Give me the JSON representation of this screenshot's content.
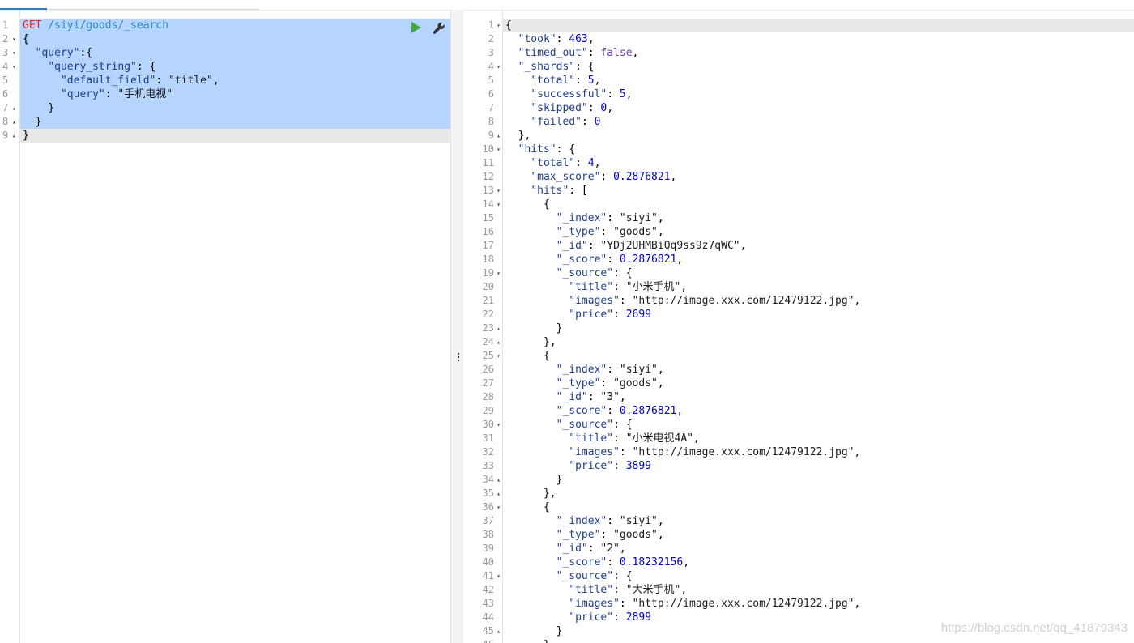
{
  "request": {
    "method": "GET",
    "path": " /siyi/goods/_search",
    "lines": [
      [
        {
          "c": "p",
          "t": "{"
        }
      ],
      [
        {
          "c": "p",
          "t": "  "
        },
        {
          "c": "k",
          "t": "\"query\""
        },
        {
          "c": "p",
          "t": ":{"
        }
      ],
      [
        {
          "c": "p",
          "t": "    "
        },
        {
          "c": "k",
          "t": "\"query_string\""
        },
        {
          "c": "p",
          "t": ": {"
        }
      ],
      [
        {
          "c": "p",
          "t": "      "
        },
        {
          "c": "k",
          "t": "\"default_field\""
        },
        {
          "c": "p",
          "t": ": "
        },
        {
          "c": "s",
          "t": "\"title\""
        },
        {
          "c": "p",
          "t": ","
        }
      ],
      [
        {
          "c": "p",
          "t": "      "
        },
        {
          "c": "k",
          "t": "\"query\""
        },
        {
          "c": "p",
          "t": ": "
        },
        {
          "c": "s",
          "t": "\"手机电视\""
        }
      ],
      [
        {
          "c": "p",
          "t": "    }"
        }
      ],
      [
        {
          "c": "p",
          "t": "  }"
        }
      ],
      [
        {
          "c": "p",
          "t": "}"
        }
      ]
    ],
    "line_numbers": [
      "1",
      "2",
      "3",
      "4",
      "5",
      "6",
      "7",
      "8",
      "9"
    ],
    "folds": [
      "",
      "down",
      "down",
      "down",
      "",
      "",
      "up",
      "up",
      "up"
    ],
    "run_icon": "play-icon",
    "settings_icon": "wrench-icon"
  },
  "response": {
    "lines": [
      [
        {
          "c": "p",
          "t": "{"
        }
      ],
      [
        {
          "c": "p",
          "t": "  "
        },
        {
          "c": "k",
          "t": "\"took\""
        },
        {
          "c": "p",
          "t": ": "
        },
        {
          "c": "n",
          "t": "463"
        },
        {
          "c": "p",
          "t": ","
        }
      ],
      [
        {
          "c": "p",
          "t": "  "
        },
        {
          "c": "k",
          "t": "\"timed_out\""
        },
        {
          "c": "p",
          "t": ": "
        },
        {
          "c": "b",
          "t": "false"
        },
        {
          "c": "p",
          "t": ","
        }
      ],
      [
        {
          "c": "p",
          "t": "  "
        },
        {
          "c": "k",
          "t": "\"_shards\""
        },
        {
          "c": "p",
          "t": ": {"
        }
      ],
      [
        {
          "c": "p",
          "t": "    "
        },
        {
          "c": "k",
          "t": "\"total\""
        },
        {
          "c": "p",
          "t": ": "
        },
        {
          "c": "n",
          "t": "5"
        },
        {
          "c": "p",
          "t": ","
        }
      ],
      [
        {
          "c": "p",
          "t": "    "
        },
        {
          "c": "k",
          "t": "\"successful\""
        },
        {
          "c": "p",
          "t": ": "
        },
        {
          "c": "n",
          "t": "5"
        },
        {
          "c": "p",
          "t": ","
        }
      ],
      [
        {
          "c": "p",
          "t": "    "
        },
        {
          "c": "k",
          "t": "\"skipped\""
        },
        {
          "c": "p",
          "t": ": "
        },
        {
          "c": "n",
          "t": "0"
        },
        {
          "c": "p",
          "t": ","
        }
      ],
      [
        {
          "c": "p",
          "t": "    "
        },
        {
          "c": "k",
          "t": "\"failed\""
        },
        {
          "c": "p",
          "t": ": "
        },
        {
          "c": "n",
          "t": "0"
        }
      ],
      [
        {
          "c": "p",
          "t": "  },"
        }
      ],
      [
        {
          "c": "p",
          "t": "  "
        },
        {
          "c": "k",
          "t": "\"hits\""
        },
        {
          "c": "p",
          "t": ": {"
        }
      ],
      [
        {
          "c": "p",
          "t": "    "
        },
        {
          "c": "k",
          "t": "\"total\""
        },
        {
          "c": "p",
          "t": ": "
        },
        {
          "c": "n",
          "t": "4"
        },
        {
          "c": "p",
          "t": ","
        }
      ],
      [
        {
          "c": "p",
          "t": "    "
        },
        {
          "c": "k",
          "t": "\"max_score\""
        },
        {
          "c": "p",
          "t": ": "
        },
        {
          "c": "n",
          "t": "0.2876821"
        },
        {
          "c": "p",
          "t": ","
        }
      ],
      [
        {
          "c": "p",
          "t": "    "
        },
        {
          "c": "k",
          "t": "\"hits\""
        },
        {
          "c": "p",
          "t": ": ["
        }
      ],
      [
        {
          "c": "p",
          "t": "      {"
        }
      ],
      [
        {
          "c": "p",
          "t": "        "
        },
        {
          "c": "k",
          "t": "\"_index\""
        },
        {
          "c": "p",
          "t": ": "
        },
        {
          "c": "s",
          "t": "\"siyi\""
        },
        {
          "c": "p",
          "t": ","
        }
      ],
      [
        {
          "c": "p",
          "t": "        "
        },
        {
          "c": "k",
          "t": "\"_type\""
        },
        {
          "c": "p",
          "t": ": "
        },
        {
          "c": "s",
          "t": "\"goods\""
        },
        {
          "c": "p",
          "t": ","
        }
      ],
      [
        {
          "c": "p",
          "t": "        "
        },
        {
          "c": "k",
          "t": "\"_id\""
        },
        {
          "c": "p",
          "t": ": "
        },
        {
          "c": "s",
          "t": "\"YDj2UHMBiQq9ss9z7qWC\""
        },
        {
          "c": "p",
          "t": ","
        }
      ],
      [
        {
          "c": "p",
          "t": "        "
        },
        {
          "c": "k",
          "t": "\"_score\""
        },
        {
          "c": "p",
          "t": ": "
        },
        {
          "c": "n",
          "t": "0.2876821"
        },
        {
          "c": "p",
          "t": ","
        }
      ],
      [
        {
          "c": "p",
          "t": "        "
        },
        {
          "c": "k",
          "t": "\"_source\""
        },
        {
          "c": "p",
          "t": ": {"
        }
      ],
      [
        {
          "c": "p",
          "t": "          "
        },
        {
          "c": "k",
          "t": "\"title\""
        },
        {
          "c": "p",
          "t": ": "
        },
        {
          "c": "s",
          "t": "\"小米手机\""
        },
        {
          "c": "p",
          "t": ","
        }
      ],
      [
        {
          "c": "p",
          "t": "          "
        },
        {
          "c": "k",
          "t": "\"images\""
        },
        {
          "c": "p",
          "t": ": "
        },
        {
          "c": "s",
          "t": "\"http://image.xxx.com/12479122.jpg\""
        },
        {
          "c": "p",
          "t": ","
        }
      ],
      [
        {
          "c": "p",
          "t": "          "
        },
        {
          "c": "k",
          "t": "\"price\""
        },
        {
          "c": "p",
          "t": ": "
        },
        {
          "c": "n",
          "t": "2699"
        }
      ],
      [
        {
          "c": "p",
          "t": "        }"
        }
      ],
      [
        {
          "c": "p",
          "t": "      },"
        }
      ],
      [
        {
          "c": "p",
          "t": "      {"
        }
      ],
      [
        {
          "c": "p",
          "t": "        "
        },
        {
          "c": "k",
          "t": "\"_index\""
        },
        {
          "c": "p",
          "t": ": "
        },
        {
          "c": "s",
          "t": "\"siyi\""
        },
        {
          "c": "p",
          "t": ","
        }
      ],
      [
        {
          "c": "p",
          "t": "        "
        },
        {
          "c": "k",
          "t": "\"_type\""
        },
        {
          "c": "p",
          "t": ": "
        },
        {
          "c": "s",
          "t": "\"goods\""
        },
        {
          "c": "p",
          "t": ","
        }
      ],
      [
        {
          "c": "p",
          "t": "        "
        },
        {
          "c": "k",
          "t": "\"_id\""
        },
        {
          "c": "p",
          "t": ": "
        },
        {
          "c": "s",
          "t": "\"3\""
        },
        {
          "c": "p",
          "t": ","
        }
      ],
      [
        {
          "c": "p",
          "t": "        "
        },
        {
          "c": "k",
          "t": "\"_score\""
        },
        {
          "c": "p",
          "t": ": "
        },
        {
          "c": "n",
          "t": "0.2876821"
        },
        {
          "c": "p",
          "t": ","
        }
      ],
      [
        {
          "c": "p",
          "t": "        "
        },
        {
          "c": "k",
          "t": "\"_source\""
        },
        {
          "c": "p",
          "t": ": {"
        }
      ],
      [
        {
          "c": "p",
          "t": "          "
        },
        {
          "c": "k",
          "t": "\"title\""
        },
        {
          "c": "p",
          "t": ": "
        },
        {
          "c": "s",
          "t": "\"小米电视4A\""
        },
        {
          "c": "p",
          "t": ","
        }
      ],
      [
        {
          "c": "p",
          "t": "          "
        },
        {
          "c": "k",
          "t": "\"images\""
        },
        {
          "c": "p",
          "t": ": "
        },
        {
          "c": "s",
          "t": "\"http://image.xxx.com/12479122.jpg\""
        },
        {
          "c": "p",
          "t": ","
        }
      ],
      [
        {
          "c": "p",
          "t": "          "
        },
        {
          "c": "k",
          "t": "\"price\""
        },
        {
          "c": "p",
          "t": ": "
        },
        {
          "c": "n",
          "t": "3899"
        }
      ],
      [
        {
          "c": "p",
          "t": "        }"
        }
      ],
      [
        {
          "c": "p",
          "t": "      },"
        }
      ],
      [
        {
          "c": "p",
          "t": "      {"
        }
      ],
      [
        {
          "c": "p",
          "t": "        "
        },
        {
          "c": "k",
          "t": "\"_index\""
        },
        {
          "c": "p",
          "t": ": "
        },
        {
          "c": "s",
          "t": "\"siyi\""
        },
        {
          "c": "p",
          "t": ","
        }
      ],
      [
        {
          "c": "p",
          "t": "        "
        },
        {
          "c": "k",
          "t": "\"_type\""
        },
        {
          "c": "p",
          "t": ": "
        },
        {
          "c": "s",
          "t": "\"goods\""
        },
        {
          "c": "p",
          "t": ","
        }
      ],
      [
        {
          "c": "p",
          "t": "        "
        },
        {
          "c": "k",
          "t": "\"_id\""
        },
        {
          "c": "p",
          "t": ": "
        },
        {
          "c": "s",
          "t": "\"2\""
        },
        {
          "c": "p",
          "t": ","
        }
      ],
      [
        {
          "c": "p",
          "t": "        "
        },
        {
          "c": "k",
          "t": "\"_score\""
        },
        {
          "c": "p",
          "t": ": "
        },
        {
          "c": "n",
          "t": "0.18232156"
        },
        {
          "c": "p",
          "t": ","
        }
      ],
      [
        {
          "c": "p",
          "t": "        "
        },
        {
          "c": "k",
          "t": "\"_source\""
        },
        {
          "c": "p",
          "t": ": {"
        }
      ],
      [
        {
          "c": "p",
          "t": "          "
        },
        {
          "c": "k",
          "t": "\"title\""
        },
        {
          "c": "p",
          "t": ": "
        },
        {
          "c": "s",
          "t": "\"大米手机\""
        },
        {
          "c": "p",
          "t": ","
        }
      ],
      [
        {
          "c": "p",
          "t": "          "
        },
        {
          "c": "k",
          "t": "\"images\""
        },
        {
          "c": "p",
          "t": ": "
        },
        {
          "c": "s",
          "t": "\"http://image.xxx.com/12479122.jpg\""
        },
        {
          "c": "p",
          "t": ","
        }
      ],
      [
        {
          "c": "p",
          "t": "          "
        },
        {
          "c": "k",
          "t": "\"price\""
        },
        {
          "c": "p",
          "t": ": "
        },
        {
          "c": "n",
          "t": "2899"
        }
      ],
      [
        {
          "c": "p",
          "t": "        }"
        }
      ],
      [
        {
          "c": "p",
          "t": "      }"
        }
      ]
    ],
    "line_numbers": [
      "1",
      "2",
      "3",
      "4",
      "5",
      "6",
      "7",
      "8",
      "9",
      "10",
      "11",
      "12",
      "13",
      "14",
      "15",
      "16",
      "17",
      "18",
      "19",
      "20",
      "21",
      "22",
      "23",
      "24",
      "25",
      "26",
      "27",
      "28",
      "29",
      "30",
      "31",
      "32",
      "33",
      "34",
      "35",
      "36",
      "37",
      "38",
      "39",
      "40",
      "41",
      "42",
      "43",
      "44",
      "45",
      "46"
    ],
    "folds": {
      "1": "down",
      "4": "down",
      "9": "up",
      "10": "down",
      "13": "down",
      "14": "down",
      "19": "down",
      "23": "up",
      "24": "up",
      "25": "down",
      "30": "down",
      "34": "up",
      "35": "up",
      "36": "down",
      "41": "down",
      "45": "up"
    }
  },
  "watermark": "https://blog.csdn.net/qq_41879343",
  "colors": {
    "selection": "#b5d5ff",
    "method": "#d2301c",
    "path": "#2d87c8",
    "run": "#45a845"
  }
}
